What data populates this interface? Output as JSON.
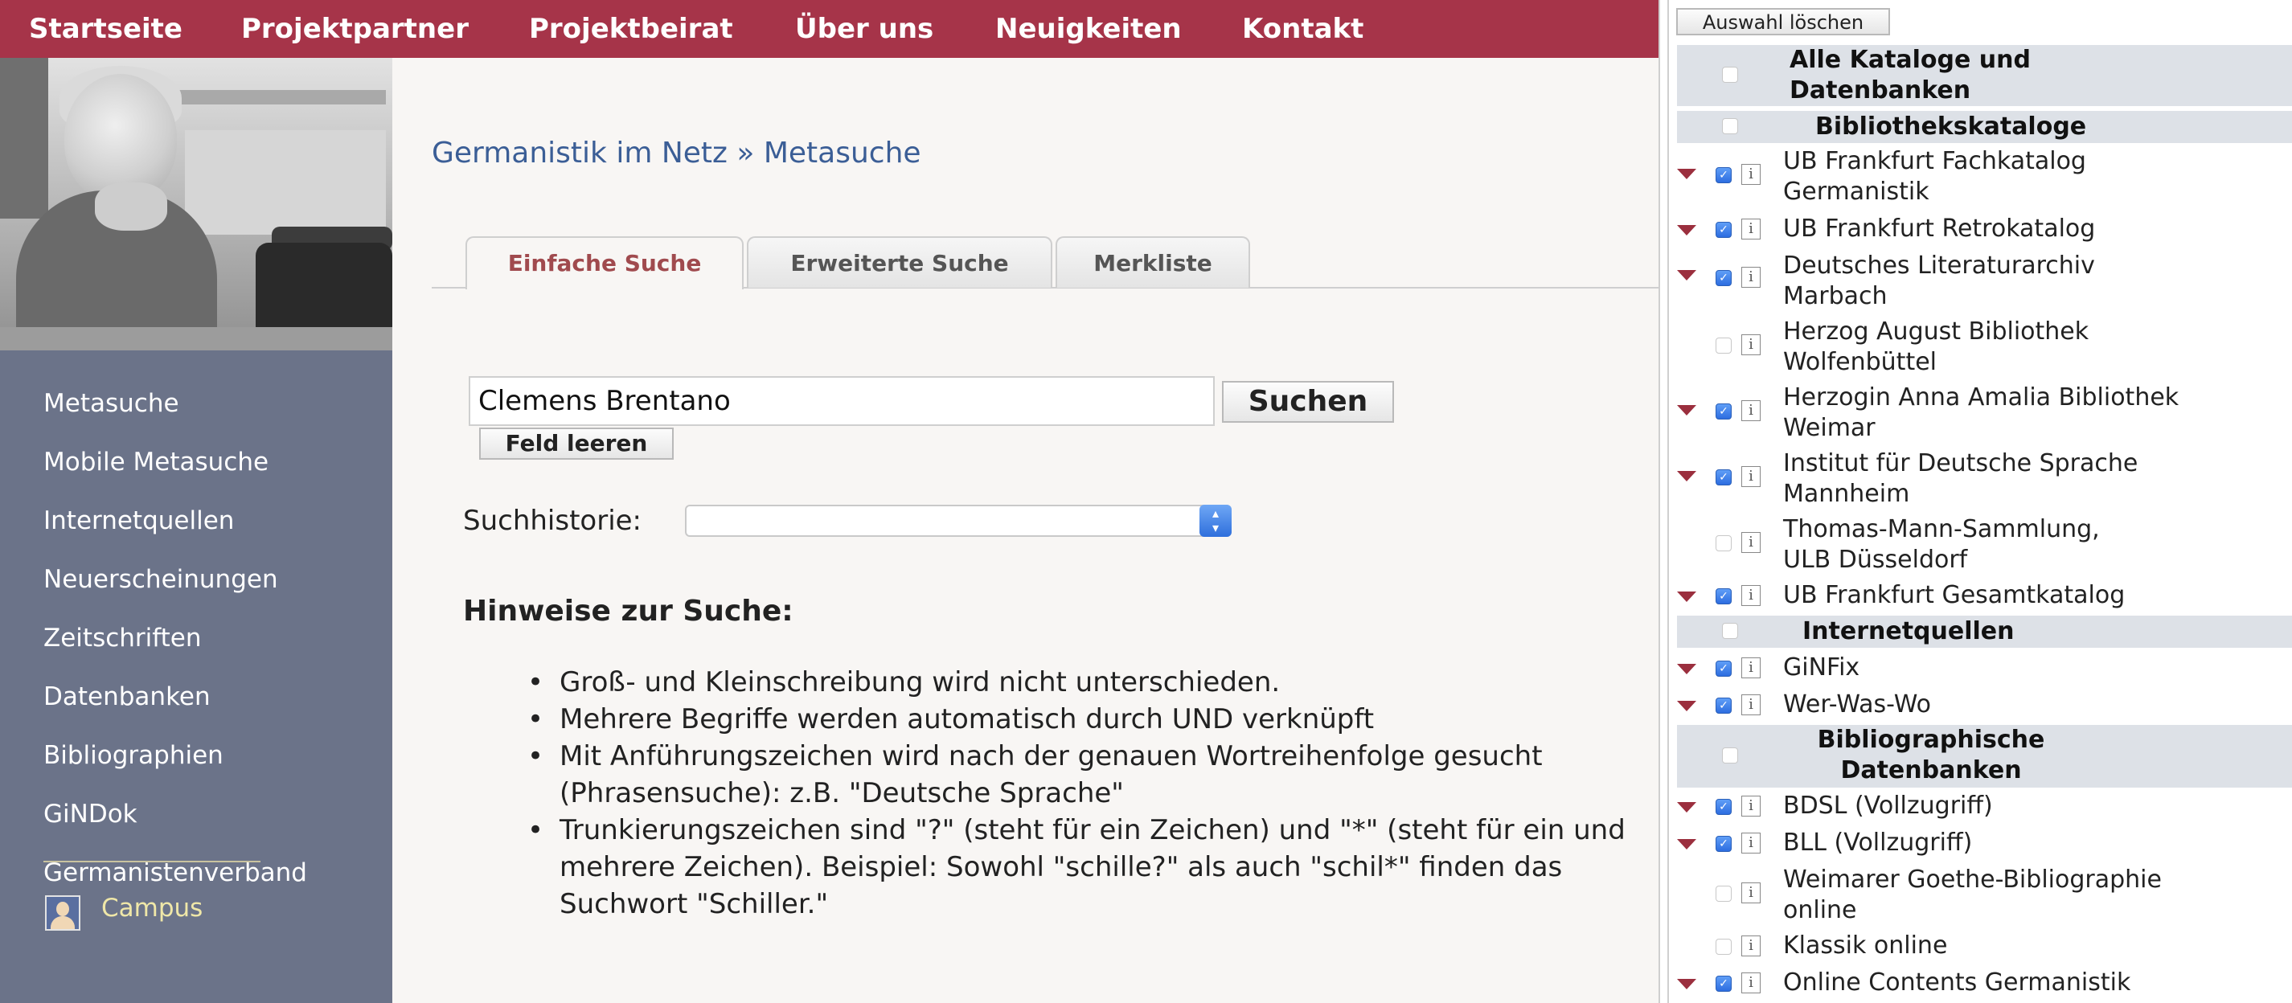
{
  "topnav": [
    "Startseite",
    "Projektpartner",
    "Projektbeirat",
    "Über uns",
    "Neuigkeiten",
    "Kontakt"
  ],
  "sidebar": {
    "items": [
      "Metasuche",
      "Mobile Metasuche",
      "Internetquellen",
      "Neuerscheinungen",
      "Zeitschriften",
      "Datenbanken",
      "Bibliographien",
      "GiNDok",
      "Germanistenverband"
    ],
    "campus": "Campus"
  },
  "breadcrumb": "Germanistik im Netz » Metasuche",
  "tabs": [
    {
      "label": "Einfache Suche",
      "active": true
    },
    {
      "label": "Erweiterte Suche",
      "active": false
    },
    {
      "label": "Merkliste",
      "active": false
    }
  ],
  "search": {
    "value": "Clemens Brentano",
    "button": "Suchen",
    "clear": "Feld leeren",
    "history_label": "Suchhistorie:",
    "history_value": ""
  },
  "hints": {
    "title": "Hinweise zur Suche:",
    "items": [
      "Groß- und Kleinschreibung wird nicht unterschieden.",
      "Mehrere Begriffe werden automatisch durch UND verknüpft",
      "Mit Anführungszeichen wird nach der genauen Wortreihenfolge gesucht (Phrasensuche): z.B. \"Deutsche Sprache\"",
      "Trunkierungszeichen sind \"?\" (steht für ein Zeichen) und \"*\" (steht für ein und mehrere Zeichen). Beispiel: Sowohl \"schille?\" als auch \"schil*\" finden das Suchwort \"Schiller.\""
    ]
  },
  "catalog": {
    "clear_label": "Auswahl löschen",
    "sections": [
      {
        "header": "Alle Kataloge und Datenbanken",
        "checked": false
      },
      {
        "header": "Bibliothekskataloge",
        "checked": false,
        "items": [
          {
            "name": "UB Frankfurt Fachkatalog Germanistik",
            "checked": true,
            "expandable": true
          },
          {
            "name": "UB Frankfurt Retrokatalog",
            "checked": true,
            "expandable": true
          },
          {
            "name": "Deutsches Literaturarchiv Marbach",
            "checked": true,
            "expandable": true
          },
          {
            "name": "Herzog August Bibliothek Wolfenbüttel",
            "checked": false,
            "expandable": false
          },
          {
            "name": "Herzogin Anna Amalia Bibliothek Weimar",
            "checked": true,
            "expandable": true
          },
          {
            "name": "Institut für Deutsche Sprache Mannheim",
            "checked": true,
            "expandable": true
          },
          {
            "name": "Thomas-Mann-Sammlung, ULB Düsseldorf",
            "checked": false,
            "expandable": false
          },
          {
            "name": "UB Frankfurt Gesamtkatalog",
            "checked": true,
            "expandable": true
          }
        ]
      },
      {
        "header": "Internetquellen",
        "checked": false,
        "items": [
          {
            "name": "GiNFix",
            "checked": true,
            "expandable": true
          },
          {
            "name": "Wer-Was-Wo",
            "checked": true,
            "expandable": true
          }
        ]
      },
      {
        "header": "Bibliographische Datenbanken",
        "checked": false,
        "items": [
          {
            "name": "BDSL (Vollzugriff)",
            "checked": true,
            "expandable": true
          },
          {
            "name": "BLL (Vollzugriff)",
            "checked": true,
            "expandable": true
          },
          {
            "name": "Weimarer Goethe-Bibliographie online",
            "checked": false,
            "expandable": false
          },
          {
            "name": "Klassik online",
            "checked": false,
            "expandable": false
          },
          {
            "name": "Online Contents Germanistik",
            "checked": true,
            "expandable": true
          }
        ]
      }
    ]
  }
}
